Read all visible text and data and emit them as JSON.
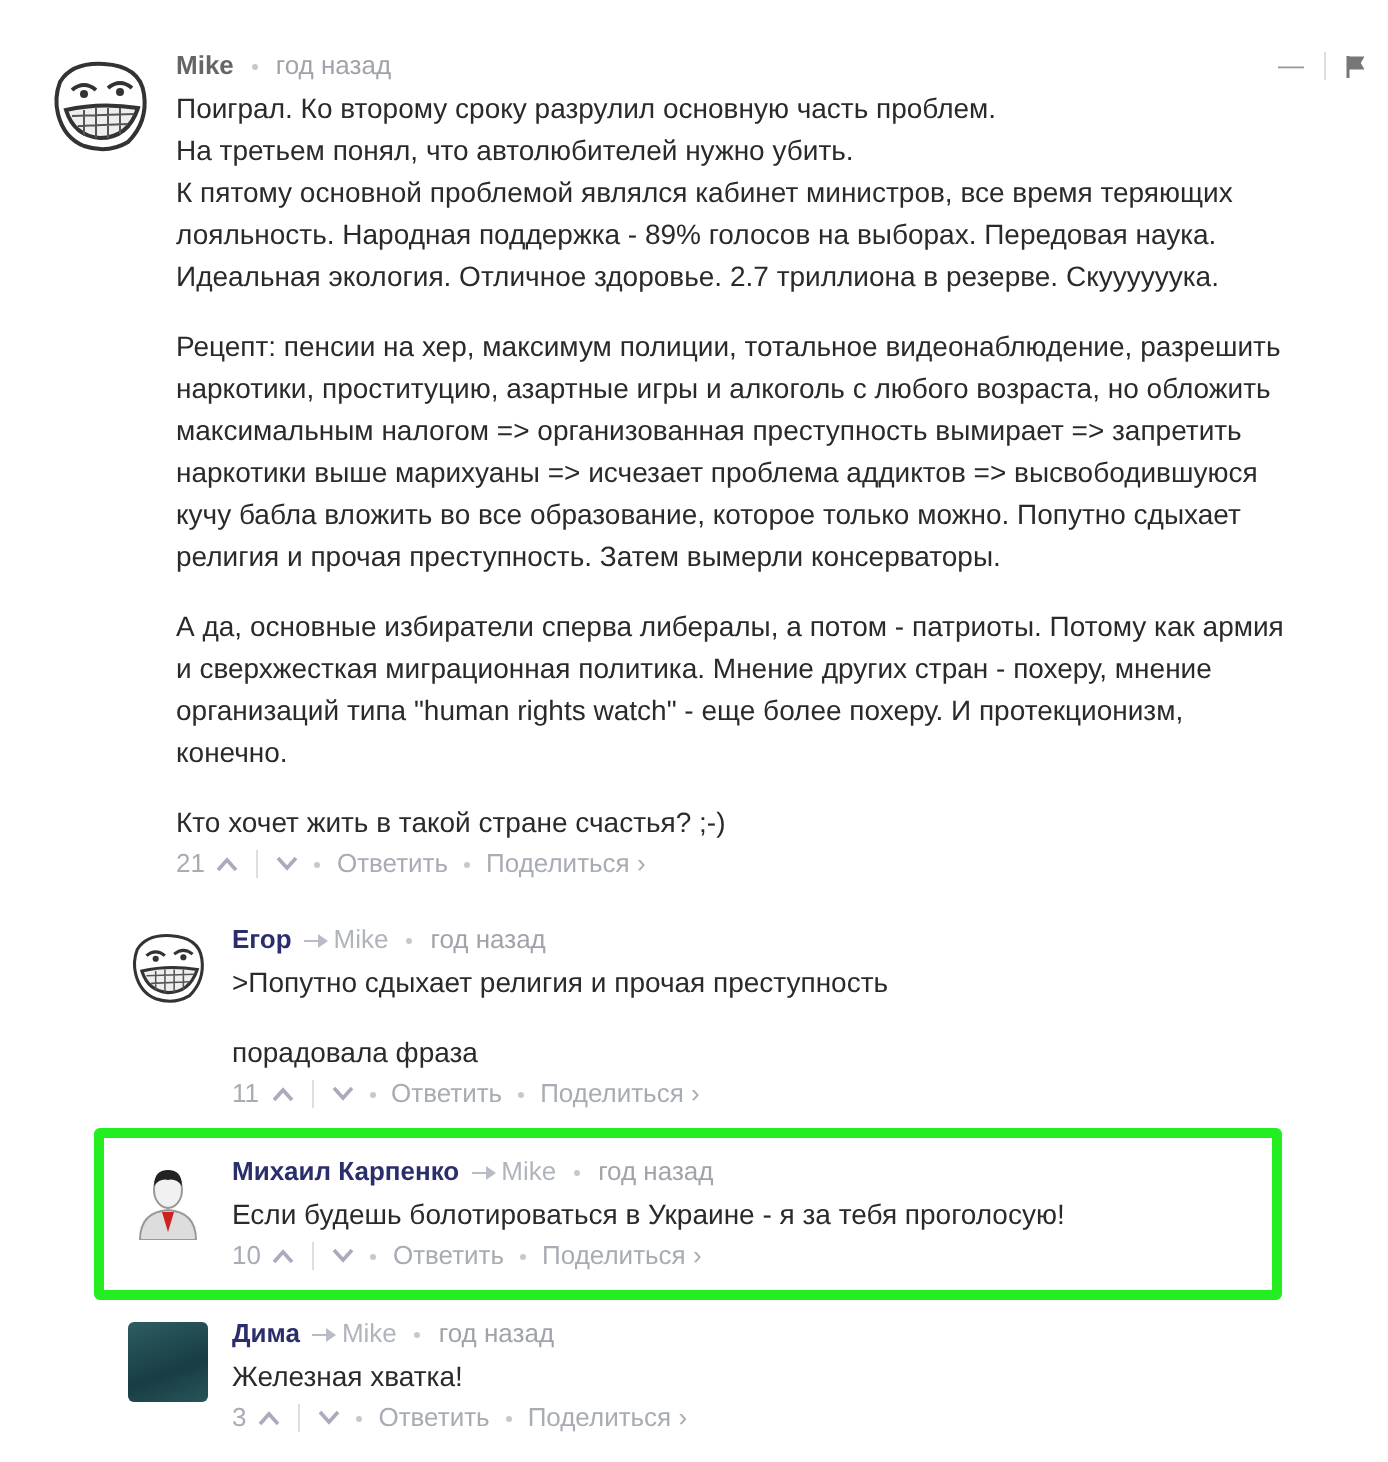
{
  "comments": [
    {
      "avatar": {
        "kind": "troll"
      },
      "author": "Mike",
      "time": "год назад",
      "highlighted": false,
      "controls": {
        "collapse": "—"
      },
      "paragraphs": [
        "Поиграл. Ко второму сроку разрулил основную часть проблем.\nНа третьем понял, что автолюбителей нужно убить.\nК пятому основной проблемой являлся кабинет министров, все время теряющих лояльность. Народная поддержка - 89% голосов на выборах. Передовая наука. Идеальная экология. Отличное здоровье. 2.7 триллиона в резерве. Скуууууука.",
        "Рецепт: пенсии на хер, максимум полиции, тотальное видеонаблюдение, разрешить наркотики, проституцию, азартные игры и алкоголь с любого возраста, но обложить максимальным налогом => организованная преступность вымирает => запретить наркотики выше марихуаны => исчезает проблема аддиктов => высвободившуюся кучу бабла вложить во все образование, которое только можно. Попутно сдыхает религия и прочая преступность. Затем вымерли консерваторы.",
        "А да, основные избиратели сперва либералы, а потом - патриоты. Потому как армия и сверхжесткая миграционная политика. Мнение других стран - похеру, мнение организаций типа \"human rights watch\" - еще более похеру. И протекционизм, конечно.",
        "Кто хочет жить в такой стране счастья? ;-)"
      ],
      "votes": "21",
      "reply": "Ответить",
      "share": "Поделиться ›",
      "children": [
        {
          "avatar": {
            "kind": "troll"
          },
          "author": "Егор",
          "reply_to": "Mike",
          "time": "год назад",
          "highlighted": false,
          "paragraphs": [
            ">Попутно сдыхает религия и прочая преступность",
            "порадовала фраза"
          ],
          "votes": "11",
          "reply": "Ответить",
          "share": "Поделиться ›"
        },
        {
          "avatar": {
            "kind": "person"
          },
          "author": "Михаил Карпенко",
          "reply_to": "Mike",
          "time": "год назад",
          "highlighted": true,
          "paragraphs": [
            "Если будешь болотироваться в Украине - я за тебя проголосую!"
          ],
          "votes": "10",
          "reply": "Ответить",
          "share": "Поделиться ›"
        },
        {
          "avatar": {
            "kind": "photo"
          },
          "author": "Дима",
          "reply_to": "Mike",
          "time": "год назад",
          "highlighted": false,
          "paragraphs": [
            "Железная хватка!"
          ],
          "votes": "3",
          "reply": "Ответить",
          "share": "Поделиться ›"
        }
      ]
    }
  ]
}
